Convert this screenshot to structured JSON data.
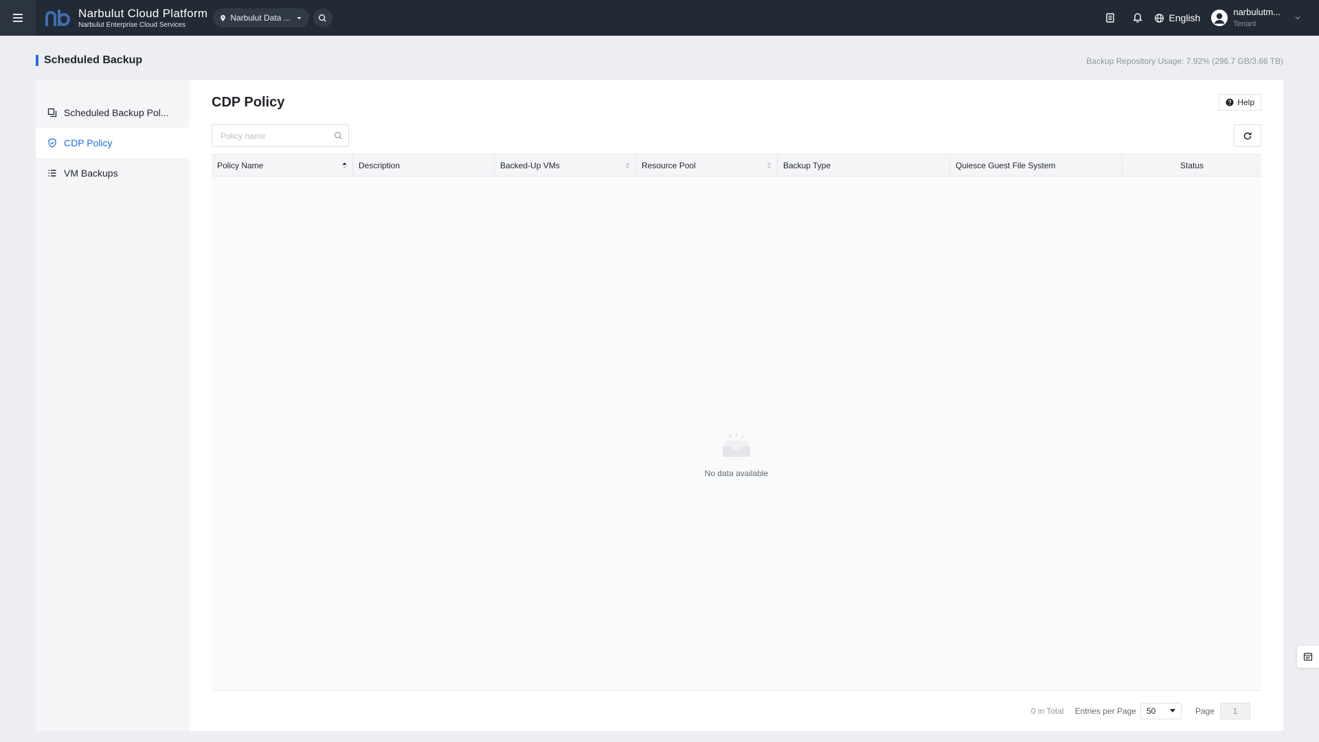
{
  "topbar": {
    "brand_title": "Narbulut Cloud Platform",
    "brand_subtitle": "Narbulut Enterprise Cloud Services",
    "region": "Narbulut Data ...",
    "language": "English",
    "user_name": "narbulutm...",
    "user_role": "Tenant",
    "colors": {
      "background": "#222a35",
      "accent": "#1f6fde"
    },
    "icons": [
      "menu-icon",
      "narbulut-logo",
      "location-pin-icon",
      "caret-down-icon",
      "search-icon",
      "document-icon",
      "bell-icon",
      "globe-icon",
      "user-icon",
      "chevron-down-icon"
    ]
  },
  "page": {
    "title": "Scheduled Backup",
    "usage": "Backup Repository Usage: 7.92% (296.7 GB/3.66 TB)"
  },
  "sidenav": {
    "items": [
      {
        "label": "Scheduled Backup Pol...",
        "icon": "copy-icon",
        "active": false
      },
      {
        "label": "CDP Policy",
        "icon": "shield-icon",
        "active": true
      },
      {
        "label": "VM Backups",
        "icon": "list-icon",
        "active": false
      }
    ]
  },
  "content": {
    "title": "CDP Policy",
    "help_label": "Help",
    "search_placeholder": "Policy name",
    "table": {
      "columns": [
        {
          "label": "Policy Name",
          "sortable": true
        },
        {
          "label": "Description",
          "sortable": false
        },
        {
          "label": "Backed-Up VMs",
          "sortable": true
        },
        {
          "label": "Resource Pool",
          "sortable": true
        },
        {
          "label": "Backup Type",
          "sortable": false
        },
        {
          "label": "Quiesce Guest File System",
          "sortable": false
        },
        {
          "label": "Status",
          "sortable": false
        }
      ],
      "rows": [],
      "empty_text": "No data available"
    },
    "pagination": {
      "total": "0 in Total",
      "entries_label": "Entries per Page",
      "entries_value": "50",
      "page_label": "Page",
      "page_value": "1"
    }
  }
}
